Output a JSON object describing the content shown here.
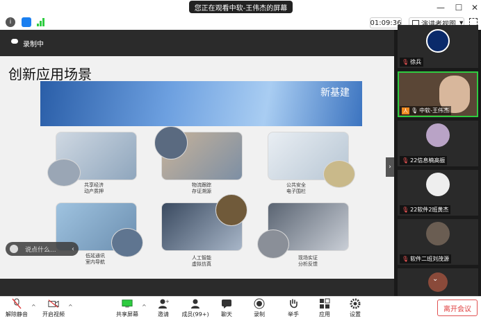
{
  "window": {
    "title": "您正在观看中软-王伟杰的屏幕"
  },
  "toolbar": {
    "clock": "01:09:36",
    "view_mode": "演讲者视图"
  },
  "recording": {
    "label": "录制中"
  },
  "slide": {
    "title": "创新应用场景",
    "banner_text": "新基建",
    "cards": [
      {
        "caption1": "共享经济",
        "caption2": "动产质押"
      },
      {
        "caption1": "物流跟踪",
        "caption2": "存证溯源"
      },
      {
        "caption1": "公共安全",
        "caption2": "电子围栏"
      },
      {
        "caption1": "低延通讯",
        "caption2": "室内导航"
      },
      {
        "caption1": "人工智能",
        "caption2": "虚拟仿真"
      },
      {
        "caption1": "现场实证",
        "caption2": "分析反馈"
      }
    ]
  },
  "chat": {
    "placeholder": "说点什么..."
  },
  "participants": [
    {
      "name": "徐兵"
    },
    {
      "name": "中软-王伟杰"
    },
    {
      "name": "22信息楠高振"
    },
    {
      "name": "22软件2班黄杰"
    },
    {
      "name": "软件二班刘茂源"
    }
  ],
  "bottombar": {
    "unmute": "解除静音",
    "video": "开启视频",
    "share": "共享屏幕",
    "invite": "邀请",
    "members": "成员(99+)",
    "chat": "聊天",
    "record": "录制",
    "hand": "举手",
    "apps": "应用",
    "settings": "设置",
    "leave": "离开会议"
  },
  "colors": {
    "accent": "#1a7ff0",
    "leave": "#e04040",
    "green": "#2ecc40"
  }
}
